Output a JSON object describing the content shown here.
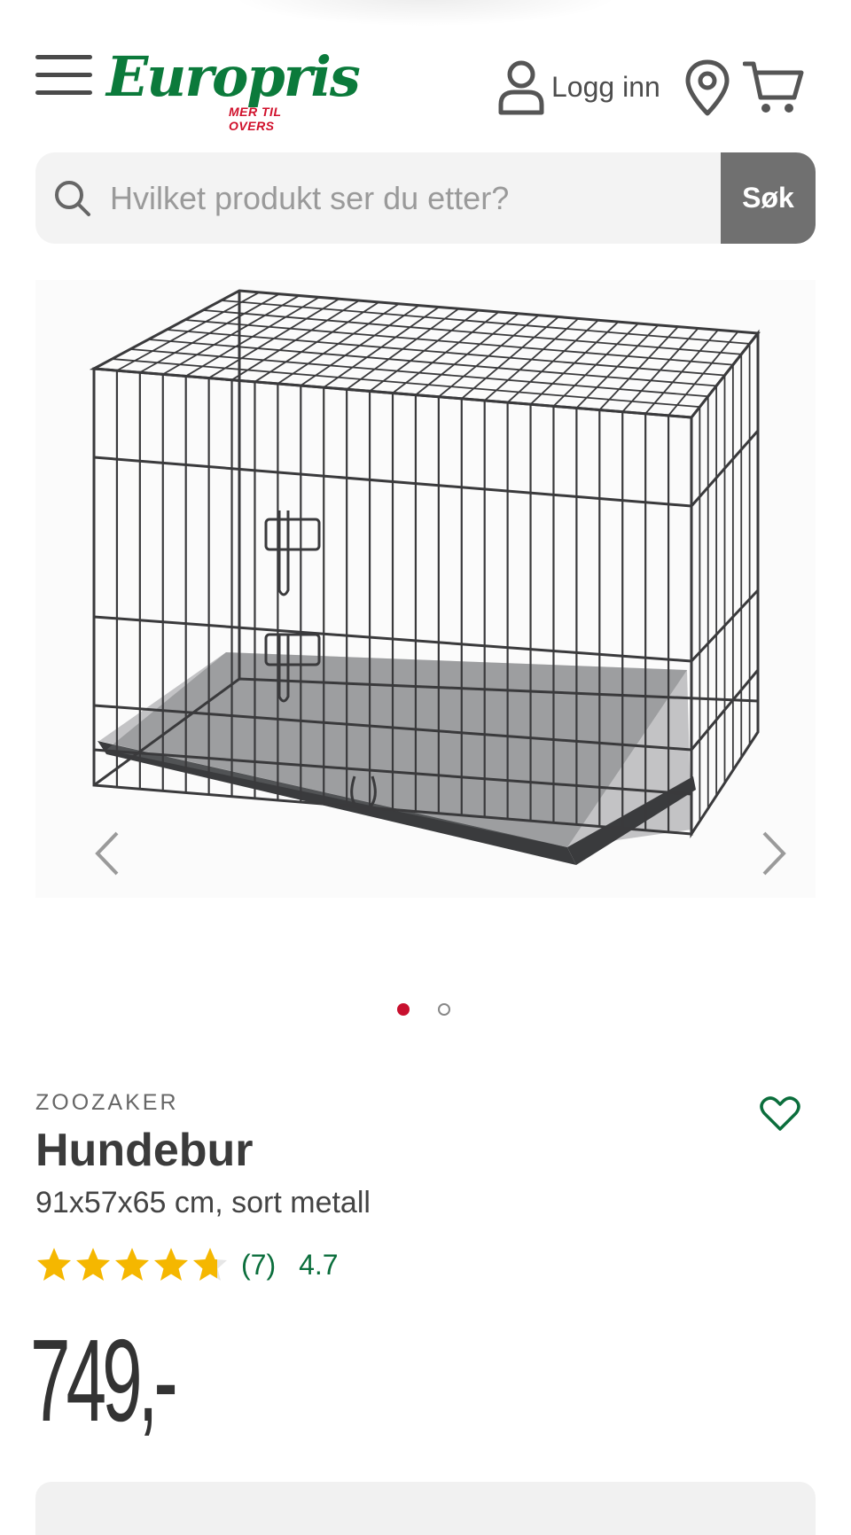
{
  "header": {
    "logo_text": "Europris",
    "logo_tagline": "MER TIL OVERS",
    "login_label": "Logg inn",
    "icons": [
      "menu-icon",
      "user-icon",
      "location-pin-icon",
      "cart-icon"
    ]
  },
  "search": {
    "placeholder": "Hvilket produkt ser du etter?",
    "value": "",
    "button_label": "Søk"
  },
  "gallery": {
    "image": "dog-cage-photo",
    "current_index": 1,
    "total": 2
  },
  "product": {
    "brand": "ZOOZAKER",
    "title": "Hundebur",
    "subtitle": "91x57x65 cm, sort metall",
    "rating": {
      "stars": 4.7,
      "count_label": "(7)",
      "average_label": "4.7"
    },
    "price": "749,-"
  },
  "colors": {
    "brand_green": "#0b7a3b",
    "brand_red": "#d0102b",
    "star_yellow": "#f5b700",
    "rating_text": "#0b6e3c",
    "search_button": "#707070"
  }
}
